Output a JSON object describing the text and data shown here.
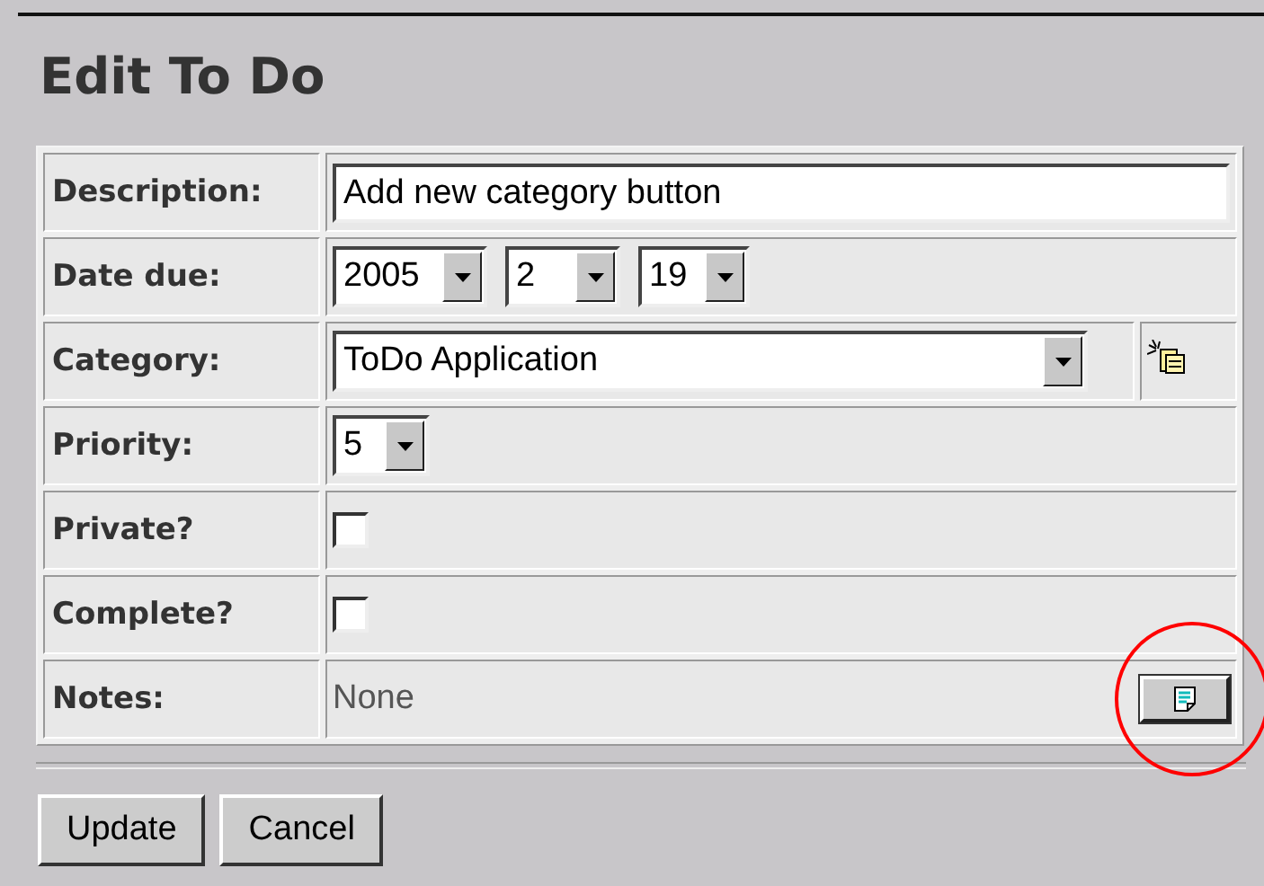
{
  "title": "Edit To Do",
  "fields": [
    {
      "kind": "text",
      "label": "Description:",
      "value": "Add new category button"
    },
    {
      "kind": "date",
      "label": "Date due:",
      "selects": [
        "2005",
        "2",
        "19"
      ]
    },
    {
      "kind": "category",
      "label": "Category:",
      "value": "ToDo Application"
    },
    {
      "kind": "select",
      "label": "Priority:",
      "value": "5"
    },
    {
      "kind": "checkbox",
      "label": "Private?",
      "checked": false
    },
    {
      "kind": "checkbox",
      "label": "Complete?",
      "checked": false
    },
    {
      "kind": "notes",
      "label": "Notes:",
      "value": "None",
      "highlighted": true
    }
  ],
  "buttons": [
    "Update",
    "Cancel"
  ]
}
